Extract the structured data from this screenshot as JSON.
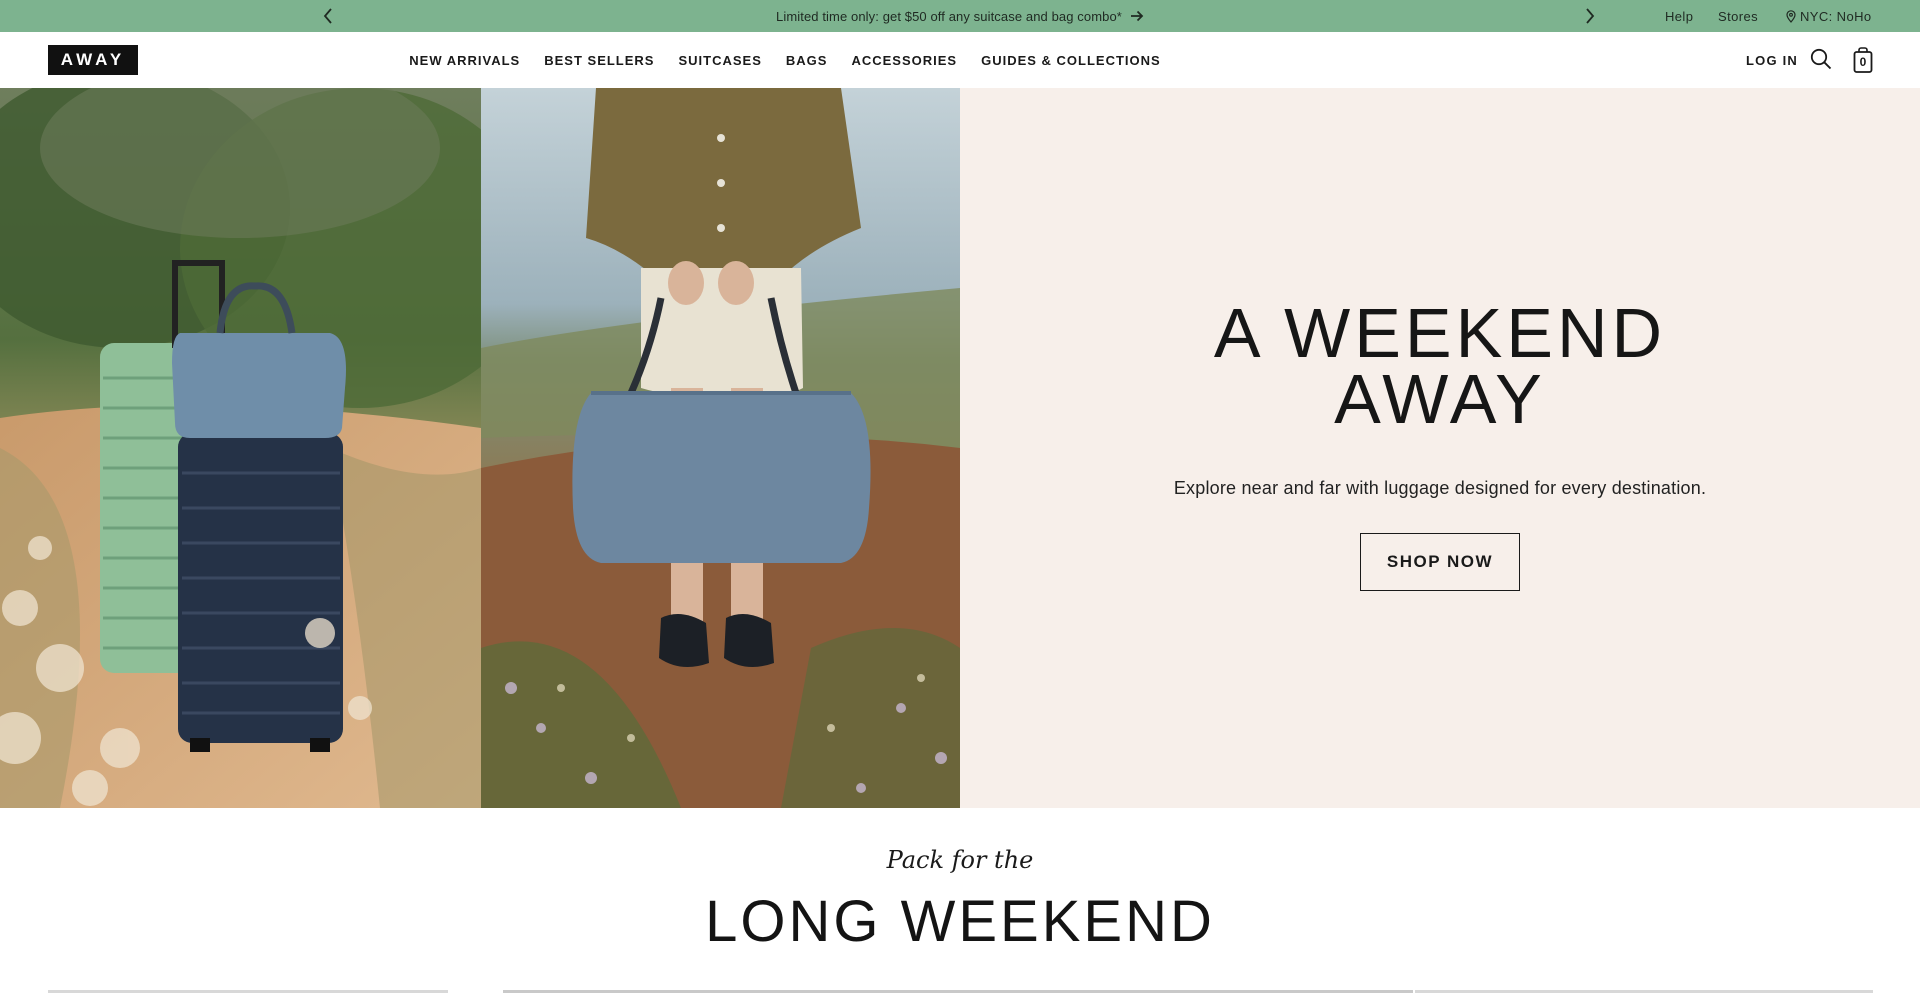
{
  "promo": {
    "message": "Limited time only: get $50 off any suitcase and bag combo*",
    "prev_icon": "chevron-left-icon",
    "next_icon": "chevron-right-icon",
    "help": "Help",
    "stores": "Stores",
    "location": "NYC: NoHo",
    "background": "#7db38f"
  },
  "header": {
    "logo": "AWAY",
    "nav": [
      "NEW ARRIVALS",
      "BEST SELLERS",
      "SUITCASES",
      "BAGS",
      "ACCESSORIES",
      "GUIDES & COLLECTIONS"
    ],
    "login": "LOG IN",
    "search_icon": "search-icon",
    "cart_icon": "shopping-bag-icon",
    "cart_count": "0"
  },
  "hero": {
    "title_line1": "A WEEKEND",
    "title_line2": "AWAY",
    "subtitle": "Explore near and far with luggage designed for every destination.",
    "cta": "SHOP NOW",
    "panel_color": "#f7efea"
  },
  "section": {
    "eyebrow": "Pack for the",
    "title": "LONG WEEKEND"
  }
}
